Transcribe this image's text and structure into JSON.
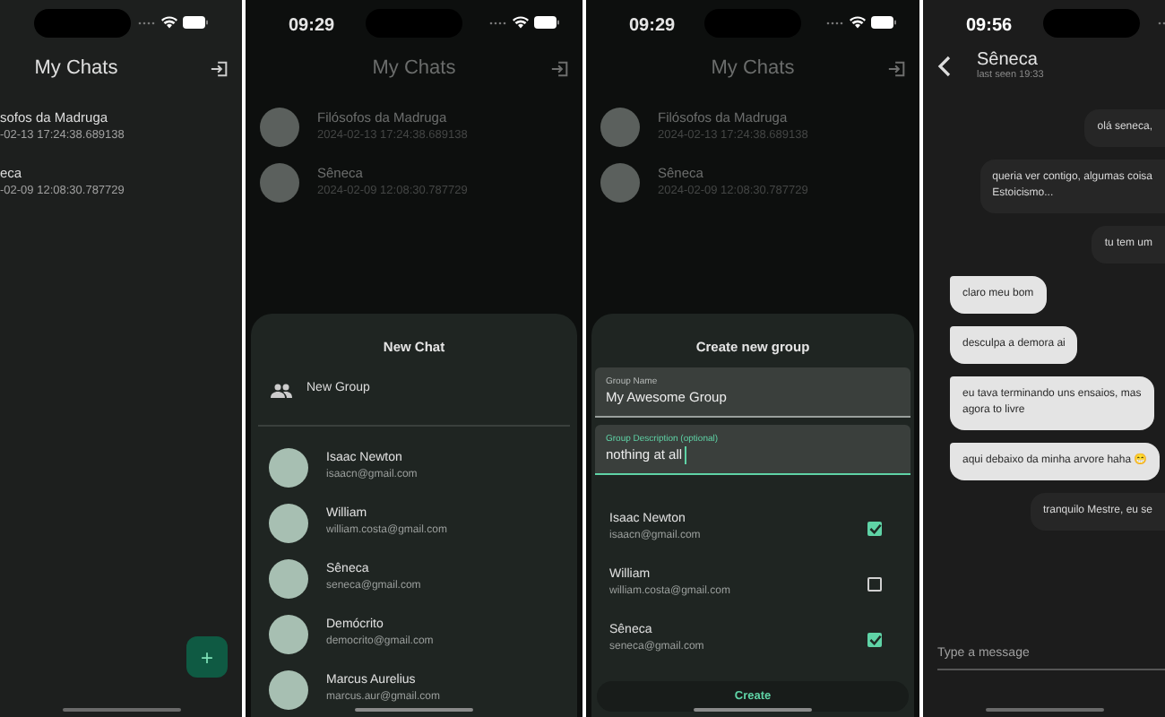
{
  "screens": [
    {
      "kind": "chat_list",
      "title": "My Chats",
      "chats": [
        {
          "name": "sofos da Madruga",
          "timestamp": "-02-13 17:24:38.689138"
        },
        {
          "name": "eca",
          "timestamp": "-02-09 12:08:30.787729"
        }
      ],
      "fab": "+"
    },
    {
      "kind": "new_chat",
      "status_time": "09:29",
      "title": "My Chats",
      "chats": [
        {
          "name": "Filósofos da Madruga",
          "timestamp": "2024-02-13 17:24:38.689138"
        },
        {
          "name": "Sêneca",
          "timestamp": "2024-02-09 12:08:30.787729"
        }
      ],
      "sheet": {
        "title": "New Chat",
        "new_group": "New Group",
        "contacts": [
          {
            "name": "Isaac Newton",
            "email": "isaacn@gmail.com"
          },
          {
            "name": "William",
            "email": "william.costa@gmail.com"
          },
          {
            "name": "Sêneca",
            "email": "seneca@gmail.com"
          },
          {
            "name": "Demócrito",
            "email": "democrito@gmail.com"
          },
          {
            "name": "Marcus Aurelius",
            "email": "marcus.aur@gmail.com"
          }
        ]
      }
    },
    {
      "kind": "create_group",
      "status_time": "09:29",
      "title": "My Chats",
      "chats": [
        {
          "name": "Filósofos da Madruga",
          "timestamp": "2024-02-13 17:24:38.689138"
        },
        {
          "name": "Sêneca",
          "timestamp": "2024-02-09 12:08:30.787729"
        }
      ],
      "sheet": {
        "title": "Create new group",
        "fields": [
          {
            "label": "Group Name",
            "value": "My Awesome Group",
            "focused": false
          },
          {
            "label": "Group Description (optional)",
            "value": "nothing at all",
            "focused": true
          }
        ],
        "members": [
          {
            "name": "Isaac Newton",
            "email": "isaacn@gmail.com",
            "checked": true
          },
          {
            "name": "William",
            "email": "william.costa@gmail.com",
            "checked": false
          },
          {
            "name": "Sêneca",
            "email": "seneca@gmail.com",
            "checked": true
          }
        ],
        "button": "Create"
      }
    },
    {
      "kind": "conversation",
      "status_time": "09:56",
      "contact": "Sêneca",
      "last_seen": "last seen 19:33",
      "messages": [
        {
          "text": "olá seneca,",
          "sent": true
        },
        {
          "text": "queria ver contigo, algumas coisa\nEstoicismo...",
          "sent": true
        },
        {
          "text": "tu tem um",
          "sent": true
        },
        {
          "text": "claro meu bom",
          "sent": false
        },
        {
          "text": "desculpa a demora ai",
          "sent": false
        },
        {
          "text": "eu tava terminando uns ensaios, mas\nagora to livre",
          "sent": false
        },
        {
          "text": "aqui debaixo da minha arvore haha 😁",
          "sent": false
        },
        {
          "text": "tranquilo Mestre, eu se",
          "sent": true
        }
      ],
      "composer": {
        "placeholder": "Type a message"
      }
    }
  ]
}
